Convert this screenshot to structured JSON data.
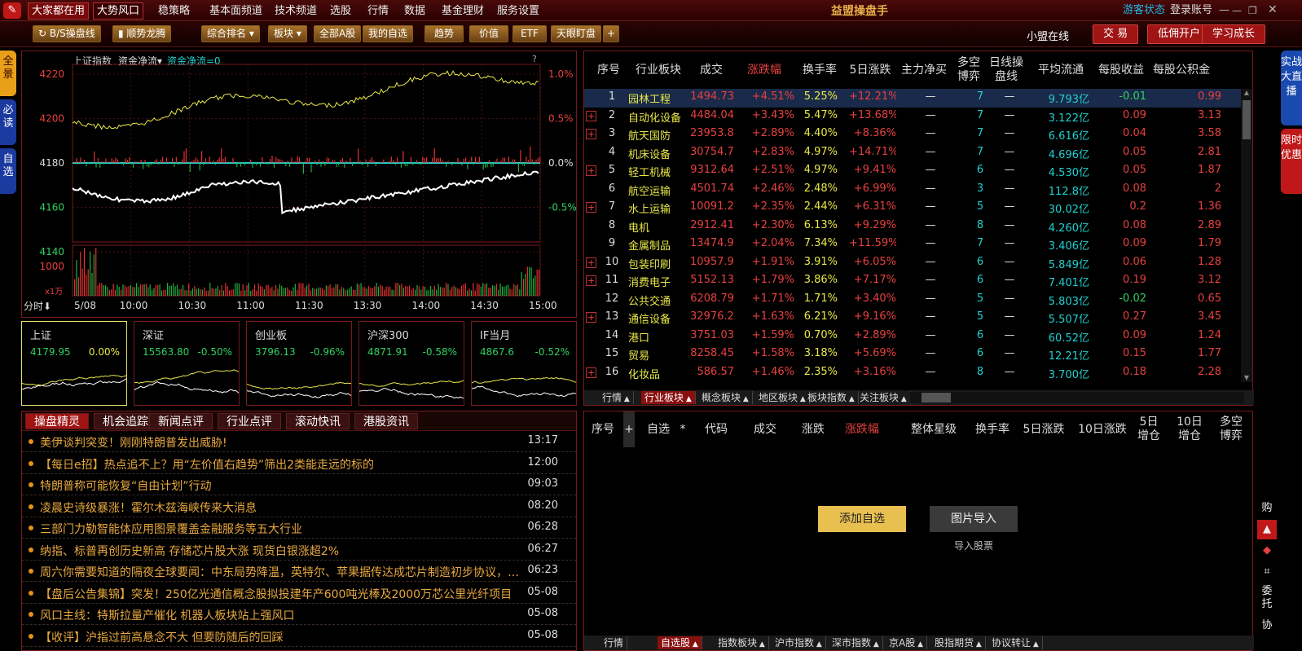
{
  "menubar": {
    "tabs": [
      "大家都在用",
      "大势风口"
    ],
    "items": [
      "稳策略",
      "基本面频道",
      "技术频道",
      "选股",
      "行情",
      "数据",
      "基金理财",
      "服务设置"
    ],
    "title": "益盟操盘手",
    "status": "游客状态",
    "login": "登录账号"
  },
  "toolbar": {
    "left": [
      "B/S操盘线",
      "顺势龙腾",
      "综合排名",
      "板块",
      "全部A股",
      "我的自选",
      "趋势",
      "价值",
      "ETF",
      "天眼盯盘"
    ],
    "right_text": "小盟在线",
    "right_buttons": [
      "交 易",
      "低佣开户",
      "学习成长"
    ]
  },
  "left_side": [
    "全景",
    "必读",
    "自选"
  ],
  "right_side": [
    "实战大直播",
    "限时优惠"
  ],
  "chart": {
    "index_name": "上证指数",
    "indicator": "资金净流",
    "indicator_value": "资金净流=0",
    "help": "?",
    "price_ticks": [
      "4220",
      "4200",
      "4180",
      "4160",
      "4140"
    ],
    "pct_ticks": [
      "1.0%",
      "0.5%",
      "0.0%",
      "-0.5%"
    ],
    "vol_tick": "1000",
    "vol_unit": "x1万",
    "period": "分时",
    "date": "5/08",
    "times": [
      "10:00",
      "10:30",
      "11:00",
      "11:30",
      "13:30",
      "14:00",
      "14:30",
      "15:00"
    ],
    "colors": {
      "price": "#ffffff",
      "avg": "#e8e84a",
      "up": "#e83030",
      "down": "#20b040",
      "flow": "#20d0d0"
    }
  },
  "mini_cards": [
    {
      "name": "上证",
      "price": "4179.95",
      "pct": "0.00%"
    },
    {
      "name": "深证",
      "price": "15563.80",
      "pct": "-0.50%"
    },
    {
      "name": "创业板",
      "price": "3796.13",
      "pct": "-0.96%"
    },
    {
      "name": "沪深300",
      "price": "4871.91",
      "pct": "-0.58%"
    },
    {
      "name": "IF当月",
      "price": "4867.6",
      "pct": "-0.52%"
    }
  ],
  "news": {
    "tabs": [
      "操盘精灵",
      "机会追踪",
      "新闻点评",
      "行业点评",
      "滚动快讯",
      "港股资讯"
    ],
    "items": [
      {
        "t": "美伊谈判突变！刚刚特朗普发出威胁!",
        "m": "13:17"
      },
      {
        "t": "【每日e招】热点追不上？用“左价值右趋势”筛出2类能走远的标的",
        "m": "12:00"
      },
      {
        "t": "特朗普称可能恢复“自由计划”行动",
        "m": "09:03"
      },
      {
        "t": "凌晨史诗级暴涨！霍尔木兹海峡传来大消息",
        "m": "08:20"
      },
      {
        "t": "三部门力勒智能体应用图景覆盖金融服务等五大行业",
        "m": "06:28"
      },
      {
        "t": "纳指、标普再创历史新高 存储芯片股大涨 现货白银涨超2%",
        "m": "06:27"
      },
      {
        "t": "周六你需要知道的隔夜全球要闻：中东局势降温，英特尔、苹果据传达成芯片制造初步协议，美...",
        "m": "06:23"
      },
      {
        "t": "【盘后公告集锦】突发！250亿光通信概念股拟投建年产600吨光棒及2000万芯公里光纤项目",
        "m": "05-08"
      },
      {
        "t": "风口主线：特斯拉量产催化 机器人板块站上强风口",
        "m": "05-08"
      },
      {
        "t": "【收评】沪指过前高悬念不大 但要防随后的回踩",
        "m": "05-08"
      }
    ]
  },
  "industry": {
    "headers": [
      "序号",
      "行业板块",
      "成交",
      "涨跌幅",
      "换手率",
      "5日涨跌",
      "主力净买",
      "多空博弈",
      "日线操盘线",
      "平均流通",
      "每股收益",
      "每股公积金"
    ],
    "rows": [
      [
        "1",
        "园林工程",
        "1494.73",
        "+4.51%",
        "5.25%",
        "+12.21%",
        "—",
        "7",
        "—",
        "9.793亿",
        "-0.01",
        "0.99"
      ],
      [
        "2",
        "自动化设备",
        "4484.04",
        "+3.43%",
        "5.47%",
        "+13.68%",
        "—",
        "7",
        "—",
        "3.122亿",
        "0.09",
        "3.13"
      ],
      [
        "3",
        "航天国防",
        "23953.83",
        "+2.89%",
        "4.40%",
        "+8.36%",
        "—",
        "7",
        "—",
        "6.616亿",
        "0.04",
        "3.58"
      ],
      [
        "4",
        "机床设备",
        "30754.75",
        "+2.83%",
        "4.97%",
        "+14.71%",
        "—",
        "7",
        "—",
        "4.696亿",
        "0.05",
        "2.81"
      ],
      [
        "5",
        "轻工机械",
        "9312.64",
        "+2.51%",
        "4.97%",
        "+9.41%",
        "—",
        "6",
        "—",
        "4.530亿",
        "0.05",
        "1.87"
      ],
      [
        "6",
        "航空运输",
        "4501.74",
        "+2.46%",
        "2.48%",
        "+6.99%",
        "—",
        "3",
        "—",
        "112.8亿",
        "0.08",
        "2"
      ],
      [
        "7",
        "水上运输",
        "10091.20",
        "+2.35%",
        "2.44%",
        "+6.31%",
        "—",
        "5",
        "—",
        "30.02亿",
        "0.2",
        "1.36"
      ],
      [
        "8",
        "电机",
        "2912.41",
        "+2.30%",
        "6.13%",
        "+9.29%",
        "—",
        "8",
        "—",
        "4.260亿",
        "0.08",
        "2.89"
      ],
      [
        "9",
        "金属制品",
        "13474.97",
        "+2.04%",
        "7.34%",
        "+11.59%",
        "—",
        "7",
        "—",
        "3.406亿",
        "0.09",
        "1.79"
      ],
      [
        "10",
        "包装印刷",
        "10957.95",
        "+1.91%",
        "3.91%",
        "+6.05%",
        "—",
        "6",
        "—",
        "5.849亿",
        "0.06",
        "1.28"
      ],
      [
        "11",
        "消费电子",
        "5152.13",
        "+1.79%",
        "3.86%",
        "+7.17%",
        "—",
        "6",
        "—",
        "7.401亿",
        "0.19",
        "3.12"
      ],
      [
        "12",
        "公共交通",
        "6208.79",
        "+1.71%",
        "1.71%",
        "+3.40%",
        "—",
        "5",
        "—",
        "5.803亿",
        "-0.02",
        "0.65"
      ],
      [
        "13",
        "通信设备",
        "32976.28",
        "+1.63%",
        "6.21%",
        "+9.16%",
        "—",
        "5",
        "—",
        "5.507亿",
        "0.27",
        "3.45"
      ],
      [
        "14",
        "港口",
        "3751.03",
        "+1.59%",
        "0.70%",
        "+2.89%",
        "—",
        "6",
        "—",
        "60.52亿",
        "0.09",
        "1.24"
      ],
      [
        "15",
        "贸易",
        "8258.45",
        "+1.58%",
        "3.18%",
        "+5.69%",
        "—",
        "6",
        "—",
        "12.21亿",
        "0.15",
        "1.77"
      ],
      [
        "16",
        "化妆品",
        "586.57",
        "+1.46%",
        "2.35%",
        "+3.16%",
        "—",
        "8",
        "—",
        "3.700亿",
        "0.18",
        "2.28"
      ]
    ],
    "plus_rows": [
      2,
      3,
      5,
      7,
      10,
      11,
      13,
      16
    ],
    "tabs": [
      "行情",
      "行业板块",
      "概念板块",
      "地区板块",
      "板块指数",
      "关注板块"
    ]
  },
  "watch": {
    "headers": [
      "序号",
      "+",
      "自选",
      "*",
      "代码",
      "成交",
      "涨跌",
      "涨跌幅",
      "整体星级",
      "换手率",
      "5日涨跌",
      "10日涨跌",
      "5日增仓",
      "10日增仓",
      "多空博弈"
    ],
    "add_button": "添加自选",
    "import_button": "图片导入",
    "import_hint": "导入股票",
    "tabs": [
      "行情",
      "自选股",
      "指数板块",
      "沪市指数",
      "深市指数",
      "京A股",
      "股指期货",
      "协议转让"
    ]
  },
  "right_tools": [
    "购",
    "委托",
    "协"
  ]
}
